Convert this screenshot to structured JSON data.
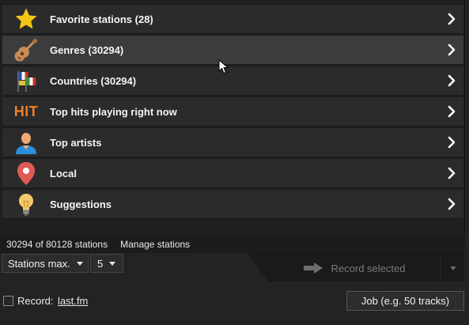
{
  "menu": {
    "items": [
      {
        "label": "Favorite stations (28)",
        "icon": "star-icon"
      },
      {
        "label": "Genres (30294)",
        "icon": "guitar-icon"
      },
      {
        "label": "Countries (30294)",
        "icon": "flags-icon"
      },
      {
        "label": "Top hits playing right now",
        "icon": "hit-icon",
        "icon_text": "HIT"
      },
      {
        "label": "Top artists",
        "icon": "person-icon"
      },
      {
        "label": "Local",
        "icon": "map-pin-icon"
      },
      {
        "label": "Suggestions",
        "icon": "lightbulb-icon"
      }
    ],
    "hovered_index": 1
  },
  "status": {
    "count": "30294 of 80128 stations",
    "manage_label": "Manage stations"
  },
  "controls": {
    "stations_max_label": "Stations max.",
    "stations_value": "5",
    "record_selected_label": "Record selected"
  },
  "bottom": {
    "record_label": "Record:",
    "record_link": "last.fm",
    "job_label": "Job (e.g. 50 tracks)"
  },
  "colors": {
    "hit_accent": "#f07e24",
    "star": "#f5c518",
    "person": "#2a8fd8",
    "pin": "#e05a55"
  }
}
